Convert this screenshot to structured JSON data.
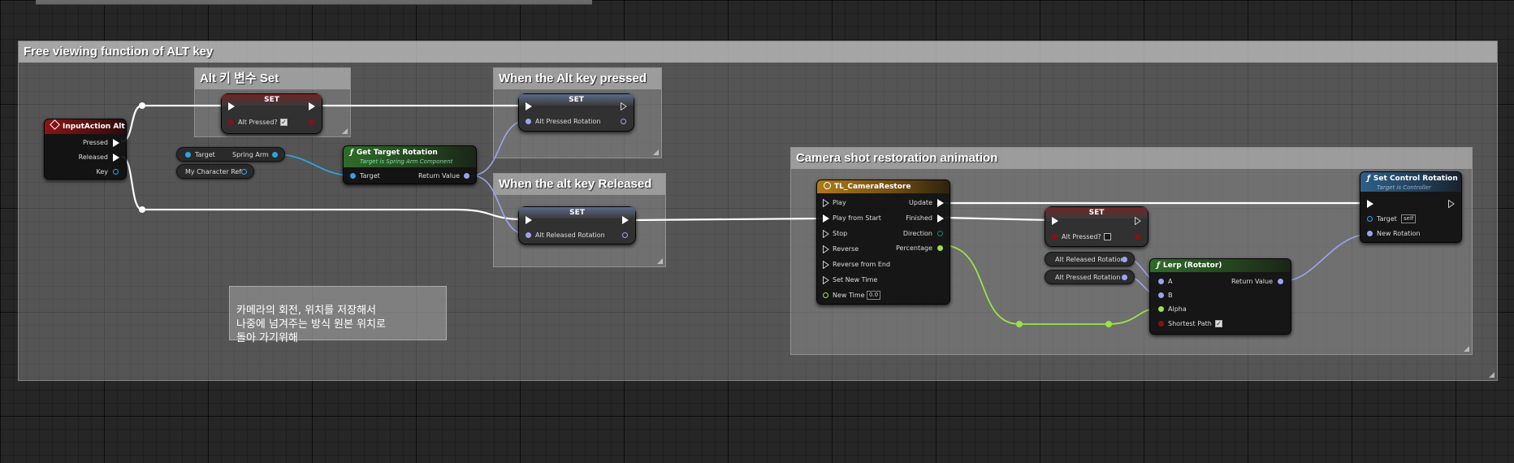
{
  "comments": {
    "main": "Free viewing function of ALT key",
    "alt_set": "Alt 키 변수 Set",
    "when_pressed": "When the Alt key pressed",
    "when_released": "When the alt key Released",
    "camera": "Camera shot restoration animation",
    "note_lines": "카메라의 회전, 위치를 저장해서\n나중에 넘겨주는 방식 원본 위치로\n돌아 가기위해"
  },
  "input_action": {
    "title": "InputAction Alt",
    "pressed": "Pressed",
    "released": "Released",
    "key": "Key"
  },
  "set_alt_pressed": {
    "title": "SET",
    "pin": "Alt Pressed?",
    "checked": true
  },
  "target_var": {
    "target": "Target",
    "value": "Spring Arm"
  },
  "character_ref": {
    "label": "My Character Ref"
  },
  "get_target_rotation": {
    "title": "Get Target Rotation",
    "subtitle": "Target is Spring Arm Component",
    "target": "Target",
    "return": "Return Value"
  },
  "set_pressed_rotation": {
    "title": "SET",
    "pin": "Alt Pressed Rotation"
  },
  "set_released_rotation": {
    "title": "SET",
    "pin": "Alt Released Rotation"
  },
  "timeline": {
    "title": "TL_CameraRestore",
    "inputs": [
      "Play",
      "Play from Start",
      "Stop",
      "Reverse",
      "Reverse from End",
      "Set New Time",
      "New Time"
    ],
    "new_time_value": "0.0",
    "outputs": [
      "Update",
      "Finished",
      "Direction",
      "Percentage"
    ]
  },
  "set_alt_pressed_2": {
    "title": "SET",
    "pin": "Alt Pressed?",
    "checked": false
  },
  "alt_released_rotation_var": "Alt Released Rotation",
  "alt_pressed_rotation_var": "Alt Pressed Rotation",
  "lerp": {
    "title": "Lerp (Rotator)",
    "a": "A",
    "b": "B",
    "alpha": "Alpha",
    "shortest": "Shortest Path",
    "return": "Return Value"
  },
  "set_control_rotation": {
    "title": "Set Control Rotation",
    "subtitle": "Target is Controller",
    "target": "Target",
    "target_value": "self",
    "new_rotation": "New Rotation"
  },
  "colors": {
    "exec_wire": "#ffffff",
    "rotator_wire": "#9aa4ee",
    "object_wire": "#2aa6e0",
    "float_wire": "#9ce24a",
    "bool_pin": "#8a1010"
  }
}
